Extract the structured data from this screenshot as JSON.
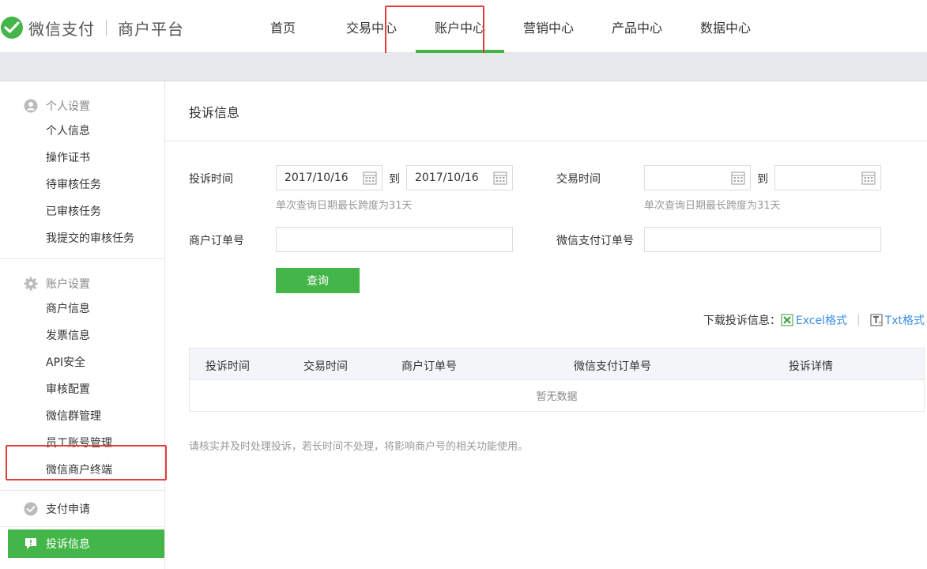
{
  "header": {
    "logo_text": "微信支付",
    "logo_sub": "商户平台",
    "nav": [
      {
        "label": "首页"
      },
      {
        "label": "交易中心"
      },
      {
        "label": "账户中心"
      },
      {
        "label": "营销中心"
      },
      {
        "label": "产品中心"
      },
      {
        "label": "数据中心"
      }
    ],
    "active_nav": "账户中心"
  },
  "sidebar": {
    "personal": {
      "head": "个人设置",
      "icon": "user-icon",
      "items": [
        "个人信息",
        "操作证书",
        "待审核任务",
        "已审核任务",
        "我提交的审核任务"
      ]
    },
    "account": {
      "head": "账户设置",
      "icon": "gear-icon",
      "items": [
        "商户信息",
        "发票信息",
        "API安全",
        "审核配置",
        "微信群管理",
        "员工账号管理",
        "微信商户终端"
      ]
    },
    "payment_apply": {
      "label": "支付申请",
      "icon": "wechat-pay-icon"
    },
    "complaint": {
      "label": "投诉信息",
      "icon": "message-icon"
    }
  },
  "main": {
    "title": "投诉信息",
    "form": {
      "complaint_time_label": "投诉时间",
      "complaint_start": "2017/10/16",
      "complaint_to": "到",
      "complaint_end": "2017/10/16",
      "complaint_hint": "单次查询日期最长跨度为31天",
      "trade_time_label": "交易时间",
      "trade_start": "",
      "trade_to": "到",
      "trade_end": "",
      "trade_hint": "单次查询日期最长跨度为31天",
      "merchant_order_label": "商户订单号",
      "merchant_order_value": "",
      "wechat_order_label": "微信支付订单号",
      "wechat_order_value": "",
      "query_button": "查询"
    },
    "download": {
      "label": "下载投诉信息：",
      "excel": "Excel格式",
      "separator": "|",
      "txt": "Txt格式"
    },
    "table": {
      "headers": [
        "投诉时间",
        "交易时间",
        "商户订单号",
        "微信支付订单号",
        "投诉详情"
      ],
      "empty_text": "暂无数据"
    },
    "footnote": "请核实并及时处理投诉，若长时间不处理，将影响商户号的相关功能使用。"
  },
  "colors": {
    "accent": "#44b549",
    "highlight": "#e23c3c",
    "link": "#3a8ee6"
  }
}
